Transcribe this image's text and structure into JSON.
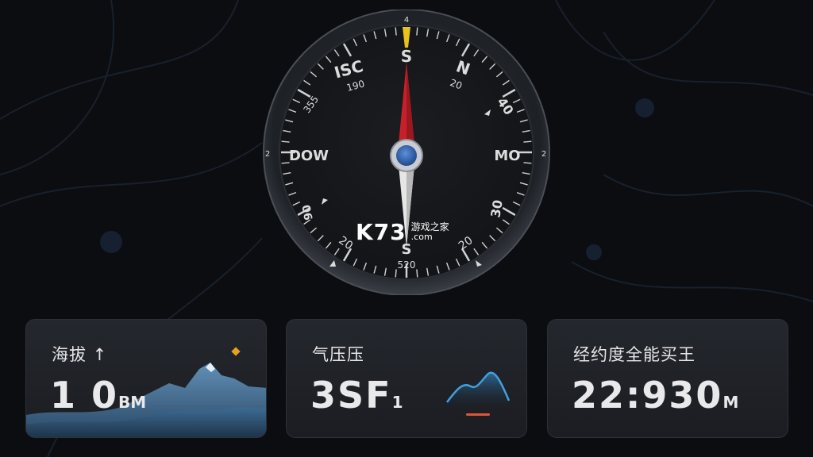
{
  "compass": {
    "labels": {
      "top": "S",
      "bottom": "S",
      "left": "DOW",
      "right": "MO",
      "top_left_a": "ISC",
      "top_left_b": "190",
      "top_right_a": "N",
      "top_right_b": "20",
      "right_upper": "40",
      "left_upper": "355",
      "left_lower": "90",
      "right_lower": "30",
      "bottom_left": "20",
      "bottom_right": "20",
      "bottom_value": "520",
      "outer_top": "4",
      "outer_left": "2",
      "outer_right": "2"
    },
    "colors": {
      "needle_north": "#c8202a",
      "needle_south": "#e6e6e6",
      "hub": "#2e5ea8",
      "north_marker": "#e7c21c",
      "bezel": "#1f2227",
      "face": "#15171b"
    }
  },
  "watermark": {
    "main": "K73",
    "cn": "游戏之家",
    "domain": ".com"
  },
  "cards": [
    {
      "title": "海拔 ↑",
      "value": "10",
      "value_prefix": "1 0",
      "unit": "BM",
      "accent": "#e8a020"
    },
    {
      "title": "气压压",
      "value": "3SF",
      "unit": "1",
      "accent": "#e0553a",
      "trend_color": "#3fa0e0"
    },
    {
      "title": "经约度全能买王",
      "value": "22:930",
      "unit": "M"
    }
  ]
}
